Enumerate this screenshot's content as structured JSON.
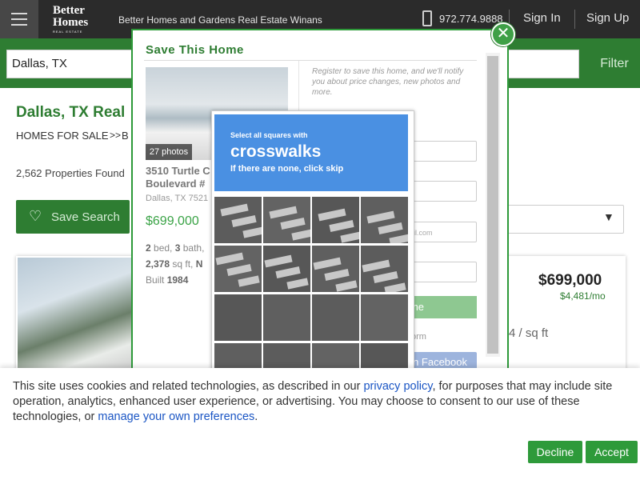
{
  "header": {
    "brand_line1": "Better",
    "brand_line2": "Homes",
    "brand_line3": "REAL ESTATE",
    "agent_name": "Better Homes and Gardens Real Estate Winans",
    "phone_number": "972.774.9888",
    "sign_in_label": "Sign In",
    "sign_up_label": "Sign Up"
  },
  "search": {
    "value": "Dallas, TX",
    "filter_label": "Filter"
  },
  "results": {
    "page_title": "Dallas, TX Real",
    "breadcrumb_homes": "HOMES FOR SALE",
    "breadcrumb_separator": ">>",
    "breadcrumb_next": "B",
    "property_count": "2,562 Properties Found",
    "save_search_label": "Save Search",
    "sort_caret": "▼"
  },
  "listing": {
    "price": "$699,000",
    "monthly": "$4,481/mo",
    "sqft_fragment": "4 / sq ft"
  },
  "modal": {
    "title": "Save This Home",
    "close_symbol": "✕",
    "photo_count": "27 photos",
    "address": "3510 Turtle C Boulevard #",
    "city": "Dallas, TX 7521",
    "price": "$699,000",
    "bed_count": "2",
    "bed_label": " bed, ",
    "bath_count": "3",
    "bath_label": " bath,",
    "sqft_value": "2,378",
    "sqft_label": " sq ft, ",
    "sqft_trail": "N",
    "built_label": "Built ",
    "built_year": "1984",
    "register_text": "Register to save this home, and we'll notify you about price changes, new photos and more.",
    "email_placeholder": "ail.com",
    "register_button": "me",
    "or_text": "orm",
    "facebook_button": "n Facebook"
  },
  "captcha": {
    "instruction_top": "Select all squares with",
    "target": "crosswalks",
    "instruction_bottom": "If there are none, click skip"
  },
  "cookie_banner": {
    "text_before_policy": "This site uses cookies and related technologies, as described in our ",
    "privacy_link": "privacy policy",
    "text_middle": ", for purposes that may include site operation, analytics, enhanced user experience, or advertising. You may choose to consent to our use of these technologies, or ",
    "preferences_link": "manage your own preferences",
    "text_end": ".",
    "decline_label": "Decline",
    "accept_label": "Accept"
  },
  "colors": {
    "brand_green": "#2e7d32",
    "captcha_blue": "#4a90e2",
    "link_blue": "#1a55c4"
  }
}
